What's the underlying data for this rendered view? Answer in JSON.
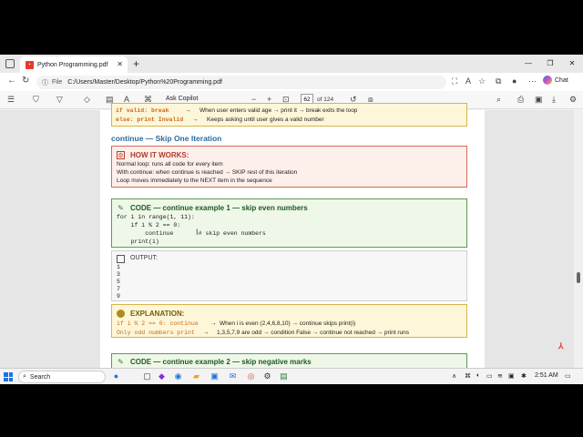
{
  "browser": {
    "tab_title": "Python Programming.pdf",
    "url_label": "File",
    "url": "C:/Users/Master/Desktop/Python%20Programming.pdf",
    "chat_label": "Chat",
    "window_controls": [
      "minimize-icon",
      "restore-icon",
      "close-icon"
    ]
  },
  "pdf_toolbar": {
    "ask_copilot": "Ask Copilot",
    "page_number": "62",
    "page_total": "of 124"
  },
  "document": {
    "top_box": {
      "lines": [
        {
          "code": "if valid: break",
          "arrow": "→",
          "desc": "When user enters valid age → print it → break exits the loop"
        },
        {
          "code": "else: print Invalid",
          "arrow": "→",
          "desc": "Keeps asking until user gives a valid number"
        }
      ]
    },
    "section_title": "continue — Skip One Iteration",
    "how_it_works": {
      "title": "HOW IT WORKS:",
      "lines": [
        "Normal loop: runs all code for every item",
        "With continue: when continue is reached → SKIP rest of this iteration",
        "Loop moves immediately to the NEXT item in the sequence"
      ]
    },
    "code1": {
      "title": "CODE — continue example 1 — skip even numbers",
      "lines": [
        "for i in range(1, 11):",
        "    if i % 2 == 0:",
        "        continue       # skip even numbers",
        "    print(i)"
      ]
    },
    "output": {
      "title": "OUTPUT:",
      "lines": [
        "1",
        "3",
        "5",
        "7",
        "9"
      ]
    },
    "explanation": {
      "title": "EXPLANATION:",
      "lines": [
        {
          "code": "if i % 2 == 0: continue",
          "arrow": "→",
          "desc": "When i is even (2,4,6,8,10) → continue skips print(i)"
        },
        {
          "code": "Only odd numbers print",
          "arrow": "→",
          "desc": "1,3,5,7,9 are odd → condition False → continue not reached → print runs"
        }
      ]
    },
    "code2": {
      "title": "CODE — continue example 2 — skip negative marks"
    }
  },
  "taskbar": {
    "search_placeholder": "Search",
    "time": "2:51 AM"
  }
}
